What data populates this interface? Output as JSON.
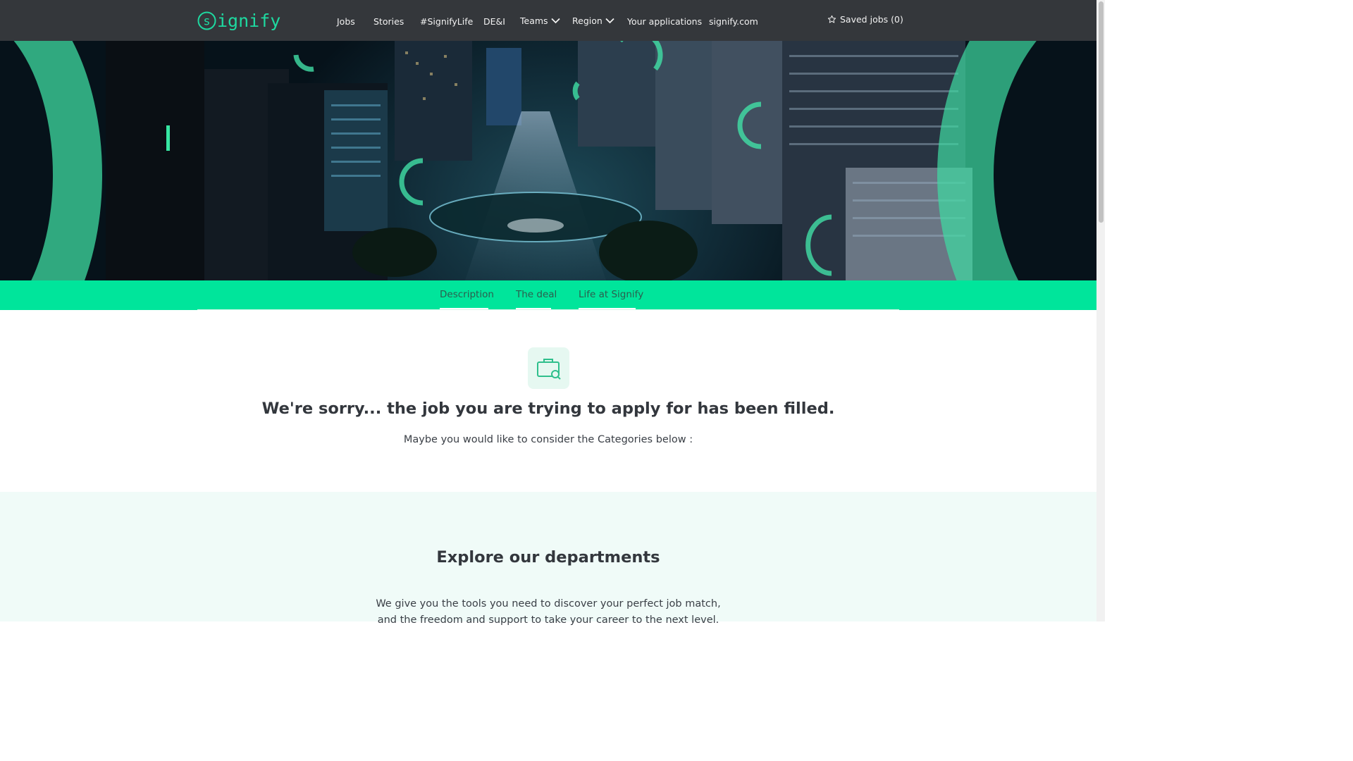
{
  "header": {
    "logo_text": "ignify",
    "nav": [
      {
        "label": "Jobs"
      },
      {
        "label": "Stories"
      },
      {
        "label": "#SignifyLife"
      },
      {
        "label": "DE&I"
      },
      {
        "label": "Teams"
      },
      {
        "label": "Region"
      },
      {
        "label": "Your applications"
      },
      {
        "label": "signify.com"
      }
    ],
    "saved_jobs_label": "Saved jobs (0)"
  },
  "tabs": [
    {
      "label": "Description"
    },
    {
      "label": "The deal"
    },
    {
      "label": "Life at Signify"
    }
  ],
  "notice": {
    "title": "We're sorry... the job you are trying to apply for has been filled.",
    "subtitle": "Maybe you would like to consider the Categories below :"
  },
  "explore": {
    "title": "Explore our departments",
    "text": "We give you the tools you need to discover your perfect job match, and the freedom and support to take your career to the next level."
  },
  "icons": {
    "logo": "signify-logo-icon",
    "dropdown": "chevron-down-icon",
    "saved": "star-outline-icon",
    "notice": "briefcase-search-icon"
  },
  "colors": {
    "brand_green": "#00e59b",
    "header_bg": "#34373b",
    "explore_bg": "#f0fbf8"
  }
}
